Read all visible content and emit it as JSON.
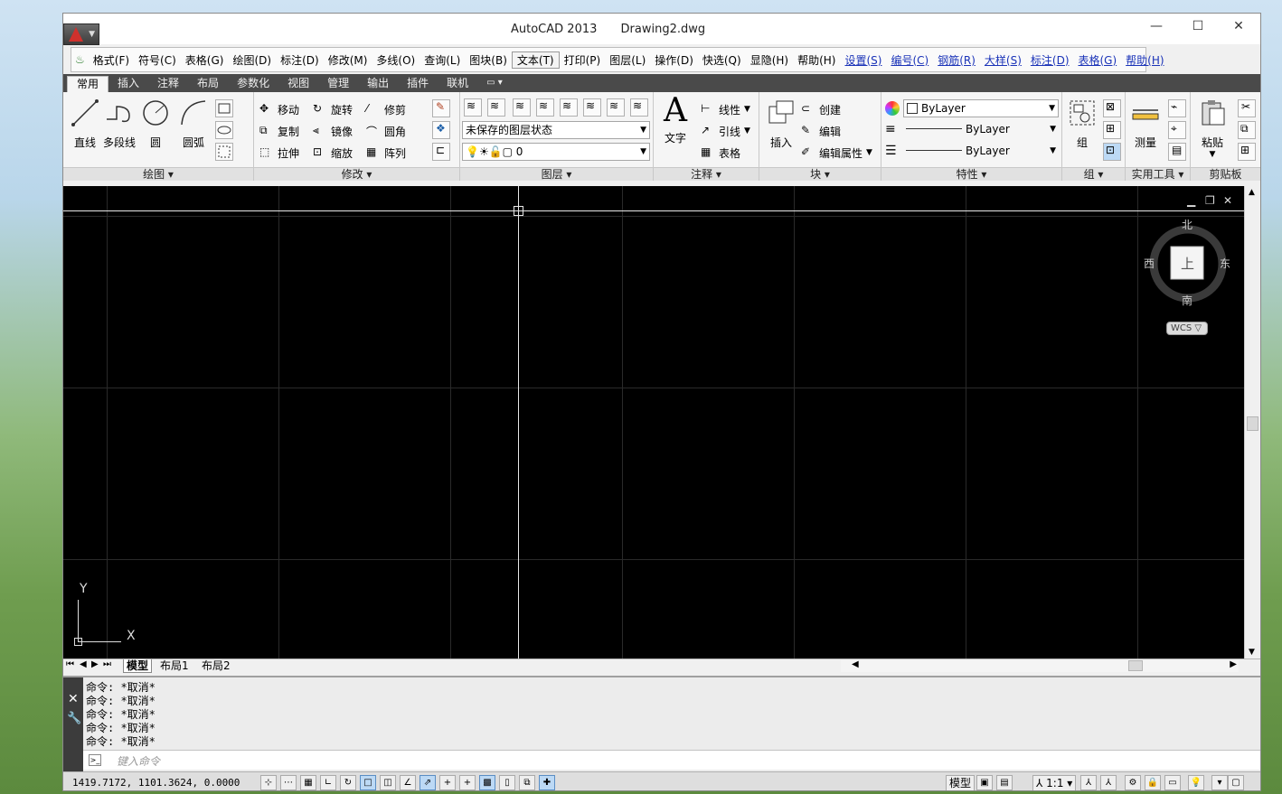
{
  "window": {
    "title_app": "AutoCAD 2013",
    "title_file": "Drawing2.dwg",
    "controls": [
      "—",
      "☐",
      "✕"
    ]
  },
  "menubar": [
    {
      "label": "格式(F)",
      "blue": false
    },
    {
      "label": "符号(C)",
      "blue": false
    },
    {
      "label": "表格(G)",
      "blue": false
    },
    {
      "label": "绘图(D)",
      "blue": false
    },
    {
      "label": "标注(D)",
      "blue": false
    },
    {
      "label": "修改(M)",
      "blue": false
    },
    {
      "label": "多线(O)",
      "blue": false
    },
    {
      "label": "查询(L)",
      "blue": false
    },
    {
      "label": "图块(B)",
      "blue": false
    },
    {
      "label": "文本(T)",
      "blue": false,
      "hover": true
    },
    {
      "label": "打印(P)",
      "blue": false
    },
    {
      "label": "图层(L)",
      "blue": false
    },
    {
      "label": "操作(D)",
      "blue": false
    },
    {
      "label": "快选(Q)",
      "blue": false
    },
    {
      "label": "显隐(H)",
      "blue": false
    },
    {
      "label": "帮助(H)",
      "blue": false
    },
    {
      "label": "设置(S)",
      "blue": true
    },
    {
      "label": "编号(C)",
      "blue": true
    },
    {
      "label": "钢筋(R)",
      "blue": true
    },
    {
      "label": "大样(S)",
      "blue": true
    },
    {
      "label": "标注(D)",
      "blue": true
    },
    {
      "label": "表格(G)",
      "blue": true
    },
    {
      "label": "帮助(H)",
      "blue": true
    }
  ],
  "ribbon_tabs": [
    "常用",
    "插入",
    "注释",
    "布局",
    "参数化",
    "视图",
    "管理",
    "输出",
    "插件",
    "联机",
    "▭ ▾"
  ],
  "panels": {
    "draw": {
      "title": "绘图 ▾",
      "line": "直线",
      "polyline": "多段线",
      "circle": "圆",
      "arc": "圆弧"
    },
    "modify": {
      "title": "修改 ▾",
      "move": "移动",
      "rotate": "旋转",
      "trim": "修剪",
      "copy": "复制",
      "mirror": "镜像",
      "fillet": "圆角",
      "stretch": "拉伸",
      "scale": "缩放",
      "array": "阵列"
    },
    "layer": {
      "title": "图层 ▾",
      "state": "未保存的图层状态",
      "current": "0"
    },
    "annotation": {
      "title": "注释 ▾",
      "text": "文字",
      "linear": "线性",
      "leader": "引线",
      "table": "表格"
    },
    "block": {
      "title": "块 ▾",
      "insert": "插入",
      "create": "创建",
      "edit": "编辑",
      "edit_attr": "编辑属性"
    },
    "properties": {
      "title": "特性 ▾",
      "color": "ByLayer",
      "linetype": "ByLayer",
      "lineweight": "ByLayer"
    },
    "group": {
      "title": "组 ▾",
      "group": "组"
    },
    "utilities": {
      "title": "实用工具 ▾",
      "measure": "测量"
    },
    "clipboard": {
      "title": "剪贴板",
      "paste": "粘贴"
    }
  },
  "viewcube": {
    "north": "北",
    "south": "南",
    "east": "东",
    "west": "西",
    "face": "上",
    "wcs": "WCS ▽"
  },
  "ucs": {
    "x": "X",
    "y": "Y"
  },
  "layout_tabs": [
    "模型",
    "布局1",
    "布局2"
  ],
  "command": {
    "history": [
      "命令: *取消*",
      "命令: *取消*",
      "命令: *取消*",
      "命令: *取消*",
      "命令: *取消*"
    ],
    "placeholder": "键入命令"
  },
  "status": {
    "coords": "1419.7172,  1101.3624,  0.0000",
    "model": "模型",
    "scale": "1:1 ▾"
  },
  "colors": {
    "canvas": "#000000",
    "ribbon_tab_bg": "#4a4a4a",
    "menu_blue": "#1a33b8"
  }
}
